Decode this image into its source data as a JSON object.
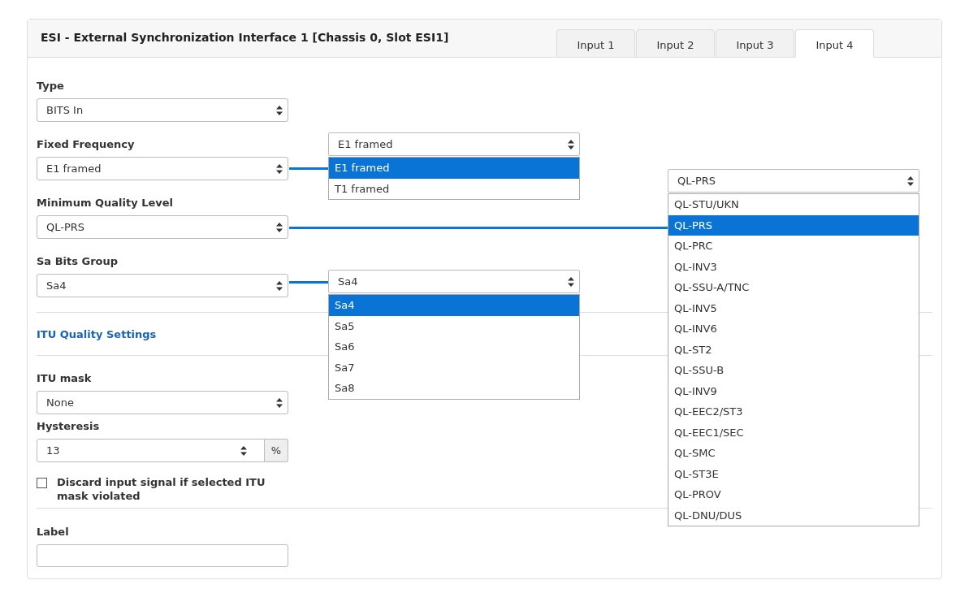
{
  "panel": {
    "title": "ESI - External Synchronization Interface 1 [Chassis 0, Slot ESI1]",
    "tabs": [
      {
        "label": "Input 1",
        "selected": false
      },
      {
        "label": "Input 2",
        "selected": false
      },
      {
        "label": "Input 3",
        "selected": false
      },
      {
        "label": "Input 4",
        "selected": true
      }
    ]
  },
  "form": [
    {
      "kind": "select",
      "label": "Type",
      "value": "BITS In"
    },
    {
      "kind": "select",
      "label": "Fixed Frequency",
      "value": "E1 framed"
    },
    {
      "kind": "select",
      "label": "Minimum Quality Level",
      "value": "QL-PRS"
    },
    {
      "kind": "select",
      "label": "Sa Bits Group",
      "value": "Sa4"
    },
    {
      "kind": "section",
      "title": "ITU Quality Settings"
    },
    {
      "kind": "select",
      "label": "ITU mask",
      "value": "None"
    },
    {
      "kind": "number",
      "label": "Hysteresis",
      "value": "13",
      "unit": "%"
    },
    {
      "kind": "checkbox",
      "label": "Discard input signal if selected ITU mask violated",
      "checked": false
    },
    {
      "kind": "text",
      "label": "Label"
    }
  ],
  "open_lists": [
    {
      "value": "E1 framed",
      "options": [
        {
          "label": "E1 framed",
          "selected": true
        },
        {
          "label": "T1 framed",
          "selected": false
        }
      ]
    },
    {
      "value": "QL-PRS",
      "options": [
        {
          "label": "QL-STU/UKN",
          "selected": false
        },
        {
          "label": "QL-PRS",
          "selected": true
        },
        {
          "label": "QL-PRC",
          "selected": false
        },
        {
          "label": "QL-INV3",
          "selected": false
        },
        {
          "label": "QL-SSU-A/TNC",
          "selected": false
        },
        {
          "label": "QL-INV5",
          "selected": false
        },
        {
          "label": "QL-INV6",
          "selected": false
        },
        {
          "label": "QL-ST2",
          "selected": false
        },
        {
          "label": "QL-SSU-B",
          "selected": false
        },
        {
          "label": "QL-INV9",
          "selected": false
        },
        {
          "label": "QL-EEC2/ST3",
          "selected": false
        },
        {
          "label": "QL-EEC1/SEC",
          "selected": false
        },
        {
          "label": "QL-SMC",
          "selected": false
        },
        {
          "label": "QL-ST3E",
          "selected": false
        },
        {
          "label": "QL-PROV",
          "selected": false
        },
        {
          "label": "QL-DNU/DUS",
          "selected": false
        }
      ]
    },
    {
      "value": "Sa4",
      "options": [
        {
          "label": "Sa4",
          "selected": true
        },
        {
          "label": "Sa5",
          "selected": false
        },
        {
          "label": "Sa6",
          "selected": false
        },
        {
          "label": "Sa7",
          "selected": false
        },
        {
          "label": "Sa8",
          "selected": false
        }
      ]
    }
  ]
}
